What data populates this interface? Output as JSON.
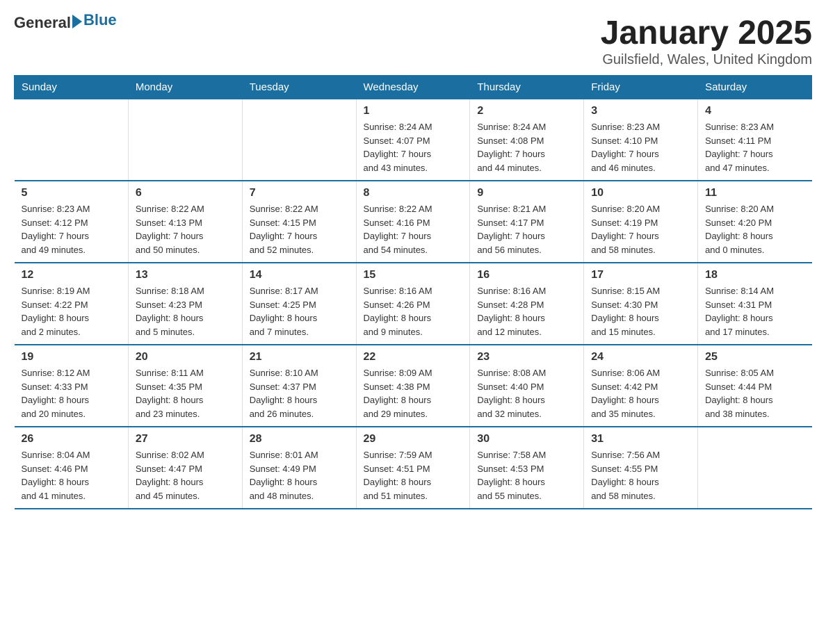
{
  "logo": {
    "text_general": "General",
    "text_blue": "Blue"
  },
  "title": "January 2025",
  "subtitle": "Guilsfield, Wales, United Kingdom",
  "days_of_week": [
    "Sunday",
    "Monday",
    "Tuesday",
    "Wednesday",
    "Thursday",
    "Friday",
    "Saturday"
  ],
  "weeks": [
    [
      {
        "day": "",
        "info": ""
      },
      {
        "day": "",
        "info": ""
      },
      {
        "day": "",
        "info": ""
      },
      {
        "day": "1",
        "info": "Sunrise: 8:24 AM\nSunset: 4:07 PM\nDaylight: 7 hours\nand 43 minutes."
      },
      {
        "day": "2",
        "info": "Sunrise: 8:24 AM\nSunset: 4:08 PM\nDaylight: 7 hours\nand 44 minutes."
      },
      {
        "day": "3",
        "info": "Sunrise: 8:23 AM\nSunset: 4:10 PM\nDaylight: 7 hours\nand 46 minutes."
      },
      {
        "day": "4",
        "info": "Sunrise: 8:23 AM\nSunset: 4:11 PM\nDaylight: 7 hours\nand 47 minutes."
      }
    ],
    [
      {
        "day": "5",
        "info": "Sunrise: 8:23 AM\nSunset: 4:12 PM\nDaylight: 7 hours\nand 49 minutes."
      },
      {
        "day": "6",
        "info": "Sunrise: 8:22 AM\nSunset: 4:13 PM\nDaylight: 7 hours\nand 50 minutes."
      },
      {
        "day": "7",
        "info": "Sunrise: 8:22 AM\nSunset: 4:15 PM\nDaylight: 7 hours\nand 52 minutes."
      },
      {
        "day": "8",
        "info": "Sunrise: 8:22 AM\nSunset: 4:16 PM\nDaylight: 7 hours\nand 54 minutes."
      },
      {
        "day": "9",
        "info": "Sunrise: 8:21 AM\nSunset: 4:17 PM\nDaylight: 7 hours\nand 56 minutes."
      },
      {
        "day": "10",
        "info": "Sunrise: 8:20 AM\nSunset: 4:19 PM\nDaylight: 7 hours\nand 58 minutes."
      },
      {
        "day": "11",
        "info": "Sunrise: 8:20 AM\nSunset: 4:20 PM\nDaylight: 8 hours\nand 0 minutes."
      }
    ],
    [
      {
        "day": "12",
        "info": "Sunrise: 8:19 AM\nSunset: 4:22 PM\nDaylight: 8 hours\nand 2 minutes."
      },
      {
        "day": "13",
        "info": "Sunrise: 8:18 AM\nSunset: 4:23 PM\nDaylight: 8 hours\nand 5 minutes."
      },
      {
        "day": "14",
        "info": "Sunrise: 8:17 AM\nSunset: 4:25 PM\nDaylight: 8 hours\nand 7 minutes."
      },
      {
        "day": "15",
        "info": "Sunrise: 8:16 AM\nSunset: 4:26 PM\nDaylight: 8 hours\nand 9 minutes."
      },
      {
        "day": "16",
        "info": "Sunrise: 8:16 AM\nSunset: 4:28 PM\nDaylight: 8 hours\nand 12 minutes."
      },
      {
        "day": "17",
        "info": "Sunrise: 8:15 AM\nSunset: 4:30 PM\nDaylight: 8 hours\nand 15 minutes."
      },
      {
        "day": "18",
        "info": "Sunrise: 8:14 AM\nSunset: 4:31 PM\nDaylight: 8 hours\nand 17 minutes."
      }
    ],
    [
      {
        "day": "19",
        "info": "Sunrise: 8:12 AM\nSunset: 4:33 PM\nDaylight: 8 hours\nand 20 minutes."
      },
      {
        "day": "20",
        "info": "Sunrise: 8:11 AM\nSunset: 4:35 PM\nDaylight: 8 hours\nand 23 minutes."
      },
      {
        "day": "21",
        "info": "Sunrise: 8:10 AM\nSunset: 4:37 PM\nDaylight: 8 hours\nand 26 minutes."
      },
      {
        "day": "22",
        "info": "Sunrise: 8:09 AM\nSunset: 4:38 PM\nDaylight: 8 hours\nand 29 minutes."
      },
      {
        "day": "23",
        "info": "Sunrise: 8:08 AM\nSunset: 4:40 PM\nDaylight: 8 hours\nand 32 minutes."
      },
      {
        "day": "24",
        "info": "Sunrise: 8:06 AM\nSunset: 4:42 PM\nDaylight: 8 hours\nand 35 minutes."
      },
      {
        "day": "25",
        "info": "Sunrise: 8:05 AM\nSunset: 4:44 PM\nDaylight: 8 hours\nand 38 minutes."
      }
    ],
    [
      {
        "day": "26",
        "info": "Sunrise: 8:04 AM\nSunset: 4:46 PM\nDaylight: 8 hours\nand 41 minutes."
      },
      {
        "day": "27",
        "info": "Sunrise: 8:02 AM\nSunset: 4:47 PM\nDaylight: 8 hours\nand 45 minutes."
      },
      {
        "day": "28",
        "info": "Sunrise: 8:01 AM\nSunset: 4:49 PM\nDaylight: 8 hours\nand 48 minutes."
      },
      {
        "day": "29",
        "info": "Sunrise: 7:59 AM\nSunset: 4:51 PM\nDaylight: 8 hours\nand 51 minutes."
      },
      {
        "day": "30",
        "info": "Sunrise: 7:58 AM\nSunset: 4:53 PM\nDaylight: 8 hours\nand 55 minutes."
      },
      {
        "day": "31",
        "info": "Sunrise: 7:56 AM\nSunset: 4:55 PM\nDaylight: 8 hours\nand 58 minutes."
      },
      {
        "day": "",
        "info": ""
      }
    ]
  ]
}
